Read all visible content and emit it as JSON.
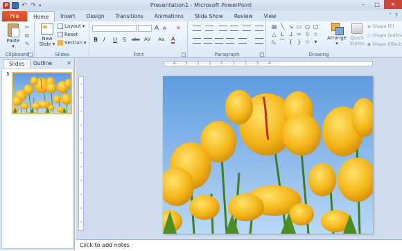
{
  "window": {
    "title": "Presentation1 - Microsoft PowerPoint",
    "app_icon_letter": "P"
  },
  "tabs": {
    "file": "File",
    "items": [
      "Home",
      "Insert",
      "Design",
      "Transitions",
      "Animations",
      "Slide Show",
      "Review",
      "View"
    ],
    "active": "Home"
  },
  "ribbon": {
    "clipboard": {
      "label": "Clipboard",
      "paste": "Paste"
    },
    "slides": {
      "label": "Slides",
      "new_slide_line1": "New",
      "new_slide_line2": "Slide",
      "layout": "Layout",
      "reset": "Reset",
      "section": "Section"
    },
    "font": {
      "label": "Font",
      "grow": "A",
      "shrink": "A",
      "bold": "B",
      "italic": "I",
      "underline": "U",
      "strike": "S",
      "shadow": "abc",
      "spacing": "AV",
      "case": "Aa",
      "color": "A"
    },
    "paragraph": {
      "label": "Paragraph"
    },
    "drawing": {
      "label": "Drawing",
      "arrange": "Arrange",
      "quick_styles_line1": "Quick",
      "quick_styles_line2": "Styles",
      "shape_fill": "Shape Fill",
      "shape_outline": "Shape Outline",
      "shape_effects": "Shape Effects"
    }
  },
  "left_pane": {
    "tabs": [
      "Slides",
      "Outline"
    ],
    "active_tab": "Slides",
    "slide_numbers": [
      "1"
    ]
  },
  "ruler": {
    "text": "·····4·····3·····2·····1·····0·····1·····2·····3·····4·····"
  },
  "notes": {
    "placeholder": "Click to add notes"
  },
  "colors": {
    "file_tab": "#d4532a",
    "ribbon": "#dce8f5",
    "accent": "#1e395b",
    "thumb_border": "#f0c040"
  }
}
